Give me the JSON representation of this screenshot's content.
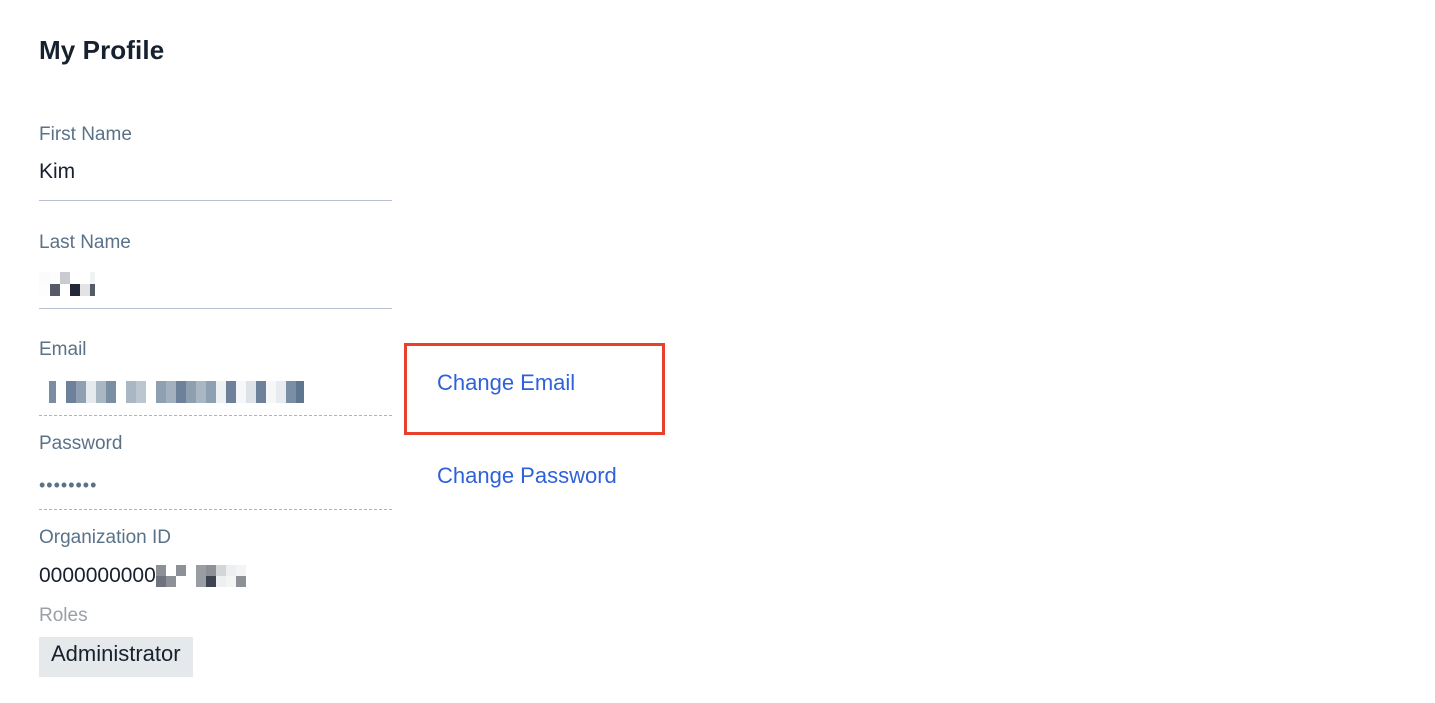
{
  "page": {
    "title": "My Profile"
  },
  "fields": {
    "first_name": {
      "label": "First Name",
      "value": "Kim"
    },
    "last_name": {
      "label": "Last Name",
      "value": "[redacted]"
    },
    "email": {
      "label": "Email",
      "value": "[redacted]"
    },
    "password": {
      "label": "Password",
      "value": "••••••••"
    },
    "organization_id": {
      "label": "Organization ID",
      "value_prefix": "0000000000",
      "value_suffix": "[redacted]"
    },
    "roles": {
      "label": "Roles",
      "items": [
        "Administrator"
      ]
    }
  },
  "actions": {
    "change_email": "Change Email",
    "change_password": "Change Password"
  },
  "colors": {
    "link": "#2f62d8",
    "label": "#5a7288",
    "highlight": "#e8412b",
    "chip_bg": "#e6e9ec"
  }
}
